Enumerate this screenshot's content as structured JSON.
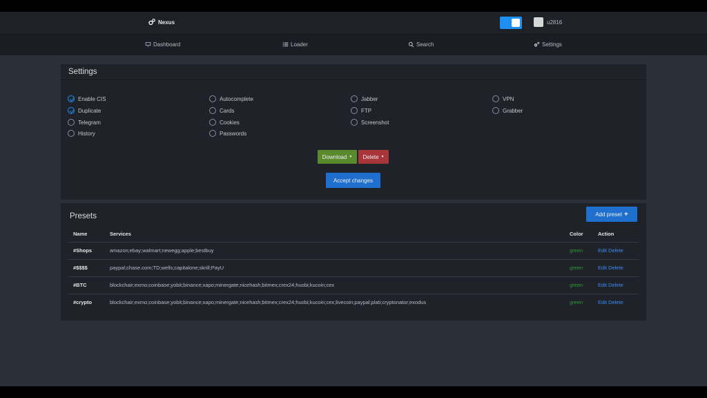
{
  "header": {
    "brand": "Nexus",
    "username": "u2816"
  },
  "nav": [
    {
      "label": "Dashboard",
      "icon": "monitor-icon"
    },
    {
      "label": "Loader",
      "icon": "list-icon"
    },
    {
      "label": "Search",
      "icon": "search-icon"
    },
    {
      "label": "Settings",
      "icon": "cogs-icon"
    }
  ],
  "settings": {
    "title": "Settings",
    "options": [
      {
        "label": "Enable CIS",
        "checked": true
      },
      {
        "label": "Duplicate",
        "checked": true
      },
      {
        "label": "Telegram",
        "checked": false
      },
      {
        "label": "History",
        "checked": false
      },
      {
        "label": "Autocomplete",
        "checked": false
      },
      {
        "label": "Cards",
        "checked": false
      },
      {
        "label": "Cookies",
        "checked": false
      },
      {
        "label": "Passwords",
        "checked": false
      },
      {
        "label": "Jabber",
        "checked": false
      },
      {
        "label": "FTP",
        "checked": false
      },
      {
        "label": "Screenshot",
        "checked": false
      },
      {
        "label": "VPN",
        "checked": false
      },
      {
        "label": "Grabber",
        "checked": false
      }
    ],
    "download_label": "Download",
    "delete_label": "Delete",
    "accept_label": "Accept changes"
  },
  "presets": {
    "title": "Presets",
    "add_label": "Add preset",
    "columns": [
      "Name",
      "Services",
      "Color",
      "Action"
    ],
    "edit_label": "Edit",
    "delete_label": "Delete",
    "rows": [
      {
        "name": "#Shops",
        "services": "amazon;ebay;walmart;newegg;apple;bestbuy",
        "color": "green"
      },
      {
        "name": "#$$$$",
        "services": "paypal;chase.com;TD;wells;capitalone;skrill;PayU",
        "color": "green"
      },
      {
        "name": "#BTC",
        "services": "blockchair;exmo;coinbase;yobit;binance;xapo;minergate;nicehash;bitmex;crex24;huobi;kucoin;cex",
        "color": "green"
      },
      {
        "name": "#crypto",
        "services": "blockchair;exmo;coinbase;yobit;binance;xapo;minergate;nicehash;bitmex;crex24;huobi;kucoin;cex;livecoin;paypal;plati;cryptonator;exodus",
        "color": "green"
      }
    ]
  },
  "colors": {
    "accent": "#1f8ef1",
    "download": "#5a8a2e",
    "delete": "#a8353a",
    "green_text": "#2f9a36"
  }
}
